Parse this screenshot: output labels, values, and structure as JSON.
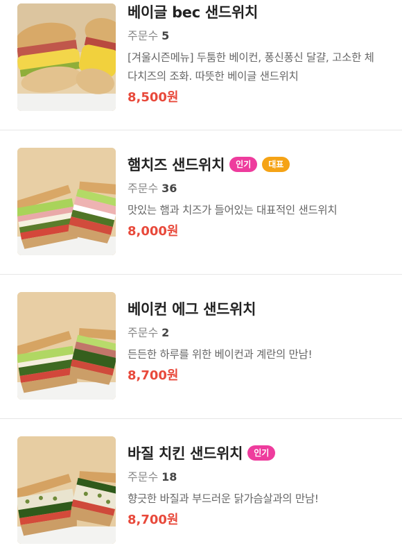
{
  "menu": {
    "items": [
      {
        "name": "베이글 bec 샌드위치",
        "orders_label": "주문수",
        "orders_count": "5",
        "description": "[겨울시즌메뉴] 두툼한 베이컨, 퐁신퐁신 달걀, 고소한 체다치즈의 조화. 따뜻한 베이글 샌드위치",
        "price": "8,500원",
        "badges": [],
        "image": "bagel-bec-sandwich-photo"
      },
      {
        "name": "햄치즈 샌드위치",
        "orders_label": "주문수",
        "orders_count": "36",
        "description": "맛있는 햄과 치즈가 들어있는 대표적인 샌드위치",
        "price": "8,000원",
        "badges": [
          "인기",
          "대표"
        ],
        "image": "ham-cheese-sandwich-photo"
      },
      {
        "name": "베이컨 에그 샌드위치",
        "orders_label": "주문수",
        "orders_count": "2",
        "description": "든든한 하루를 위한 베이컨과 계란의 만남!",
        "price": "8,700원",
        "badges": [],
        "image": "bacon-egg-sandwich-photo"
      },
      {
        "name": "바질 치킨 샌드위치",
        "orders_label": "주문수",
        "orders_count": "18",
        "description": "향긋한 바질과 부드러운 닭가슴살과의 만남!",
        "price": "8,700원",
        "badges": [
          "인기"
        ],
        "image": "basil-chicken-sandwich-photo"
      }
    ]
  },
  "colors": {
    "price": "#e8493b",
    "badge_popular": "#ee3c9d",
    "badge_signature": "#f5a316",
    "divider": "#e6e6e6"
  }
}
